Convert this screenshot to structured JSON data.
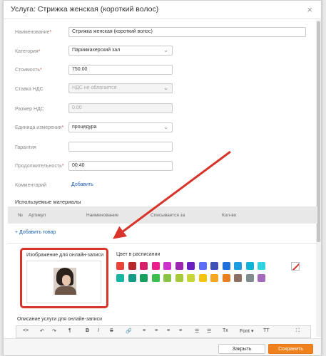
{
  "dialog": {
    "title": "Услуга: Стрижка женская (короткий волос)",
    "close_symbol": "×"
  },
  "fields": {
    "name": {
      "label": "Наименование",
      "value": "Стрижка женская (короткий волос)"
    },
    "category": {
      "label": "Категория",
      "value": "Парикмахерский зал"
    },
    "cost": {
      "label": "Стоимость",
      "value": "750.00"
    },
    "vat_rate": {
      "label": "Ставка НДС",
      "value": "НДС не облагается"
    },
    "vat_amount": {
      "label": "Размер НДС",
      "value": "0.00"
    },
    "unit": {
      "label": "Единица измерения",
      "value": "процедура"
    },
    "warranty": {
      "label": "Гарантия",
      "value": ""
    },
    "duration": {
      "label": "Продолжительность",
      "value": "00:40"
    },
    "comment": {
      "label": "Комментарий",
      "link": "Добавить"
    }
  },
  "materials": {
    "title": "Используемые материалы",
    "columns": [
      "№",
      "Артикул",
      "Наименование",
      "Списывается за",
      "Кол-во"
    ],
    "add_link": "+ Добавить товар"
  },
  "online_image": {
    "label": "Изображение для онлайн-записи"
  },
  "schedule_color": {
    "label": "Цвет в расписании",
    "colors_row1": [
      "#e8443a",
      "#b7282e",
      "#d81f6a",
      "#e91e8c",
      "#cc33cc",
      "#9b27b0",
      "#6a1fbf",
      "#5b6ef5",
      "#3f51b5",
      "#1e6fd9",
      "#1b9be0",
      "#10b3d6",
      "#2fd4e0"
    ],
    "colors_row2": [
      "#16b5a4",
      "#159b85",
      "#17a05d",
      "#3dbd4e",
      "#8ac34a",
      "#a5c83c",
      "#c8d63a",
      "#f1c40f",
      "#f5a623",
      "#e67e22",
      "#8d6e63",
      "#7f8c8d",
      "#a569bd"
    ]
  },
  "description": {
    "label": "Описание услуги для онлайн-записи",
    "toolbar": [
      "<>",
      "↶",
      "↷",
      "¶",
      "B",
      "I",
      "S",
      "🔗",
      "≡",
      "≡",
      "≡",
      "≡",
      "☰",
      "☰",
      "Tx",
      "Font",
      "T"
    ]
  },
  "footer": {
    "close_label": "Закрыть",
    "save_label": "Сохранить"
  },
  "annotation": {
    "arrow_color": "#d8342a"
  }
}
